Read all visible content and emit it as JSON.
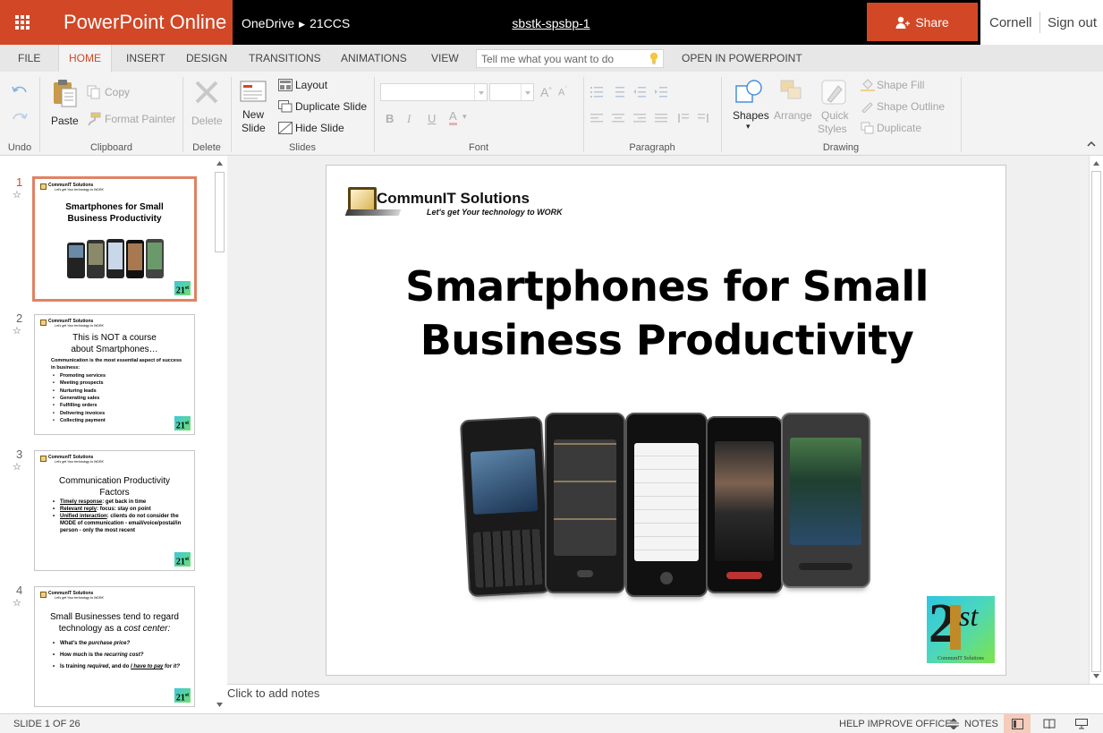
{
  "app": {
    "name": "PowerPoint Online",
    "breadcrumb": [
      "OneDrive",
      "21CCS"
    ],
    "document_title": "sbstk-spsbp-1",
    "share_label": "Share",
    "user_name": "Cornell",
    "sign_out_label": "Sign out"
  },
  "tabs": {
    "file": "FILE",
    "home": "HOME",
    "insert": "INSERT",
    "design": "DESIGN",
    "transitions": "TRANSITIONS",
    "animations": "ANIMATIONS",
    "view": "VIEW",
    "tell_me_placeholder": "Tell me what you want to do",
    "open_in": "OPEN IN POWERPOINT",
    "active": "HOME",
    "accent_color": "#d24726"
  },
  "ribbon": {
    "undo_group": "Undo",
    "clipboard": {
      "label": "Clipboard",
      "paste": "Paste",
      "copy": "Copy",
      "format_painter": "Format Painter"
    },
    "delete": {
      "label": "Delete",
      "button": "Delete"
    },
    "slides": {
      "label": "Slides",
      "new_slide_1": "New",
      "new_slide_2": "Slide",
      "layout": "Layout",
      "duplicate": "Duplicate Slide",
      "hide": "Hide Slide"
    },
    "font": {
      "label": "Font"
    },
    "paragraph": {
      "label": "Paragraph"
    },
    "drawing": {
      "label": "Drawing",
      "shapes": "Shapes",
      "arrange": "Arrange",
      "quick_styles_1": "Quick",
      "quick_styles_2": "Styles",
      "shape_fill": "Shape Fill",
      "shape_outline": "Shape Outline",
      "duplicate": "Duplicate"
    }
  },
  "thumbnails": [
    {
      "number": "1",
      "logo_name": "CommunIT Solutions",
      "logo_tagline": "Let's get Your technology to WORK",
      "title": "Smartphones for Small Business Productivity",
      "badge": "21",
      "badge_sup": "st"
    },
    {
      "number": "2",
      "title": "This is NOT a course about Smartphones…",
      "intro": "Communication is the most essential aspect of success in business:",
      "items": [
        "Promoting services",
        "Meeting prospects",
        "Nurturing leads",
        "Generating sales",
        "Fulfilling orders",
        "Delivering invoices",
        "Collecting payment"
      ]
    },
    {
      "number": "3",
      "title": "Communication Productivity Factors",
      "items": [
        {
          "u": "Timely response",
          "rest": ": get back in time"
        },
        {
          "u": "Relevant reply",
          "rest": ": focus: stay on point"
        },
        {
          "u": "Unified interaction",
          "rest": ": clients do not consider the MODE of communication - email/voice/postal/in person - only the most recent"
        }
      ]
    },
    {
      "number": "4",
      "title_1": "Small Businesses tend to regard technology as a",
      "title_2": "cost center:",
      "items": [
        {
          "a": "What's the ",
          "i": "purchase price?"
        },
        {
          "a": "How much is the ",
          "i": "recurring cost?"
        },
        {
          "a": "Is training ",
          "i": "required",
          "b": ", and do ",
          "u": "I have to pay",
          "c": " for it?"
        }
      ]
    }
  ],
  "slide": {
    "logo_name": "CommunIT Solutions",
    "logo_tagline": "Let's get Your technology to WORK",
    "title_line1": "Smartphones for Small",
    "title_line2": "Business Productivity",
    "badge_2": "2",
    "badge_1": "1",
    "badge_st": "st",
    "badge_label": "CommunIT Solutions"
  },
  "notes_placeholder": "Click to add notes",
  "status": {
    "slide_counter": "SLIDE 1 OF 26",
    "help": "HELP IMPROVE OFFICE",
    "notes": "NOTES"
  }
}
